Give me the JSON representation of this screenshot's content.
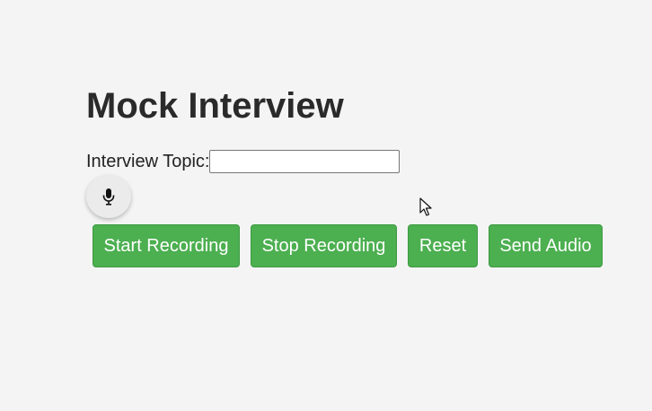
{
  "page": {
    "title": "Mock Interview"
  },
  "topic": {
    "label": "Interview Topic:",
    "value": "",
    "placeholder": ""
  },
  "mic": {
    "icon": "microphone-icon"
  },
  "buttons": {
    "start": "Start Recording",
    "stop": "Stop Recording",
    "reset": "Reset",
    "send": "Send Audio"
  },
  "colors": {
    "background": "#f4f4f4",
    "button": "#4caf50",
    "button_text": "#ffffff",
    "mic_background": "#ebebeb"
  }
}
